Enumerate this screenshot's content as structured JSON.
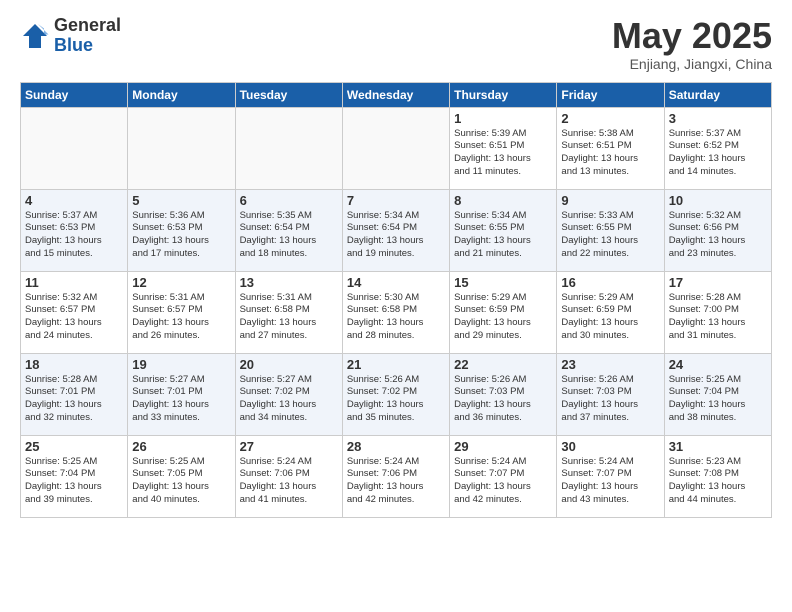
{
  "logo": {
    "general": "General",
    "blue": "Blue"
  },
  "title": "May 2025",
  "location": "Enjiang, Jiangxi, China",
  "days_of_week": [
    "Sunday",
    "Monday",
    "Tuesday",
    "Wednesday",
    "Thursday",
    "Friday",
    "Saturday"
  ],
  "weeks": [
    [
      {
        "day": "",
        "info": ""
      },
      {
        "day": "",
        "info": ""
      },
      {
        "day": "",
        "info": ""
      },
      {
        "day": "",
        "info": ""
      },
      {
        "day": "1",
        "info": "Sunrise: 5:39 AM\nSunset: 6:51 PM\nDaylight: 13 hours\nand 11 minutes."
      },
      {
        "day": "2",
        "info": "Sunrise: 5:38 AM\nSunset: 6:51 PM\nDaylight: 13 hours\nand 13 minutes."
      },
      {
        "day": "3",
        "info": "Sunrise: 5:37 AM\nSunset: 6:52 PM\nDaylight: 13 hours\nand 14 minutes."
      }
    ],
    [
      {
        "day": "4",
        "info": "Sunrise: 5:37 AM\nSunset: 6:53 PM\nDaylight: 13 hours\nand 15 minutes."
      },
      {
        "day": "5",
        "info": "Sunrise: 5:36 AM\nSunset: 6:53 PM\nDaylight: 13 hours\nand 17 minutes."
      },
      {
        "day": "6",
        "info": "Sunrise: 5:35 AM\nSunset: 6:54 PM\nDaylight: 13 hours\nand 18 minutes."
      },
      {
        "day": "7",
        "info": "Sunrise: 5:34 AM\nSunset: 6:54 PM\nDaylight: 13 hours\nand 19 minutes."
      },
      {
        "day": "8",
        "info": "Sunrise: 5:34 AM\nSunset: 6:55 PM\nDaylight: 13 hours\nand 21 minutes."
      },
      {
        "day": "9",
        "info": "Sunrise: 5:33 AM\nSunset: 6:55 PM\nDaylight: 13 hours\nand 22 minutes."
      },
      {
        "day": "10",
        "info": "Sunrise: 5:32 AM\nSunset: 6:56 PM\nDaylight: 13 hours\nand 23 minutes."
      }
    ],
    [
      {
        "day": "11",
        "info": "Sunrise: 5:32 AM\nSunset: 6:57 PM\nDaylight: 13 hours\nand 24 minutes."
      },
      {
        "day": "12",
        "info": "Sunrise: 5:31 AM\nSunset: 6:57 PM\nDaylight: 13 hours\nand 26 minutes."
      },
      {
        "day": "13",
        "info": "Sunrise: 5:31 AM\nSunset: 6:58 PM\nDaylight: 13 hours\nand 27 minutes."
      },
      {
        "day": "14",
        "info": "Sunrise: 5:30 AM\nSunset: 6:58 PM\nDaylight: 13 hours\nand 28 minutes."
      },
      {
        "day": "15",
        "info": "Sunrise: 5:29 AM\nSunset: 6:59 PM\nDaylight: 13 hours\nand 29 minutes."
      },
      {
        "day": "16",
        "info": "Sunrise: 5:29 AM\nSunset: 6:59 PM\nDaylight: 13 hours\nand 30 minutes."
      },
      {
        "day": "17",
        "info": "Sunrise: 5:28 AM\nSunset: 7:00 PM\nDaylight: 13 hours\nand 31 minutes."
      }
    ],
    [
      {
        "day": "18",
        "info": "Sunrise: 5:28 AM\nSunset: 7:01 PM\nDaylight: 13 hours\nand 32 minutes."
      },
      {
        "day": "19",
        "info": "Sunrise: 5:27 AM\nSunset: 7:01 PM\nDaylight: 13 hours\nand 33 minutes."
      },
      {
        "day": "20",
        "info": "Sunrise: 5:27 AM\nSunset: 7:02 PM\nDaylight: 13 hours\nand 34 minutes."
      },
      {
        "day": "21",
        "info": "Sunrise: 5:26 AM\nSunset: 7:02 PM\nDaylight: 13 hours\nand 35 minutes."
      },
      {
        "day": "22",
        "info": "Sunrise: 5:26 AM\nSunset: 7:03 PM\nDaylight: 13 hours\nand 36 minutes."
      },
      {
        "day": "23",
        "info": "Sunrise: 5:26 AM\nSunset: 7:03 PM\nDaylight: 13 hours\nand 37 minutes."
      },
      {
        "day": "24",
        "info": "Sunrise: 5:25 AM\nSunset: 7:04 PM\nDaylight: 13 hours\nand 38 minutes."
      }
    ],
    [
      {
        "day": "25",
        "info": "Sunrise: 5:25 AM\nSunset: 7:04 PM\nDaylight: 13 hours\nand 39 minutes."
      },
      {
        "day": "26",
        "info": "Sunrise: 5:25 AM\nSunset: 7:05 PM\nDaylight: 13 hours\nand 40 minutes."
      },
      {
        "day": "27",
        "info": "Sunrise: 5:24 AM\nSunset: 7:06 PM\nDaylight: 13 hours\nand 41 minutes."
      },
      {
        "day": "28",
        "info": "Sunrise: 5:24 AM\nSunset: 7:06 PM\nDaylight: 13 hours\nand 42 minutes."
      },
      {
        "day": "29",
        "info": "Sunrise: 5:24 AM\nSunset: 7:07 PM\nDaylight: 13 hours\nand 42 minutes."
      },
      {
        "day": "30",
        "info": "Sunrise: 5:24 AM\nSunset: 7:07 PM\nDaylight: 13 hours\nand 43 minutes."
      },
      {
        "day": "31",
        "info": "Sunrise: 5:23 AM\nSunset: 7:08 PM\nDaylight: 13 hours\nand 44 minutes."
      }
    ]
  ]
}
